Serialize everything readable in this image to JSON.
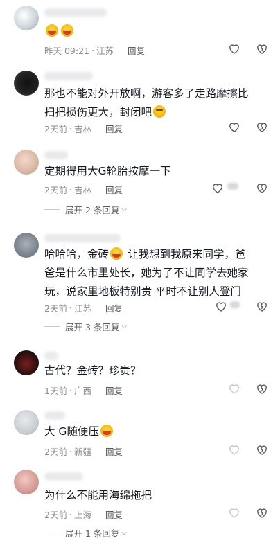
{
  "comments": [
    {
      "text": "",
      "emoji": [
        "laugh-cry",
        "laugh-cry"
      ],
      "time": "昨天 09:21",
      "location": "江苏",
      "reply": "回复"
    },
    {
      "text": "那也不能对外开放啊，游客多了走路摩擦比扫把损伤更大，封闭吧",
      "time": "2天前",
      "location": "吉林",
      "reply": "回复"
    },
    {
      "text": "定期得用大G轮胎按摩一下",
      "time": "2天前",
      "location": "吉林",
      "reply": "回复",
      "expand": "展开 2 条回复"
    },
    {
      "text_a": "哈哈哈，金砖",
      "text_b": "让我想到我原来同学，爸爸是什么市里处长，她为了不让同学去她家玩，说家里地板特别贵 平时不让别人登门",
      "time": "2天前",
      "location": "江苏",
      "reply": "回复",
      "expand": "展开 3 条回复"
    },
    {
      "text": "古代？金砖？珍贵？",
      "time": "1天前",
      "location": "广西",
      "reply": "回复"
    },
    {
      "text": "大 G随便压",
      "time": "2天前",
      "location": "新疆",
      "reply": "回复"
    },
    {
      "text": "为什么不能用海绵拖把",
      "time": "2天前",
      "location": "上海",
      "reply": "回复",
      "expand": "展开 1 条回复"
    }
  ],
  "icons": {
    "like": "heart-outline-icon",
    "dislike": "broken-heart-icon"
  }
}
